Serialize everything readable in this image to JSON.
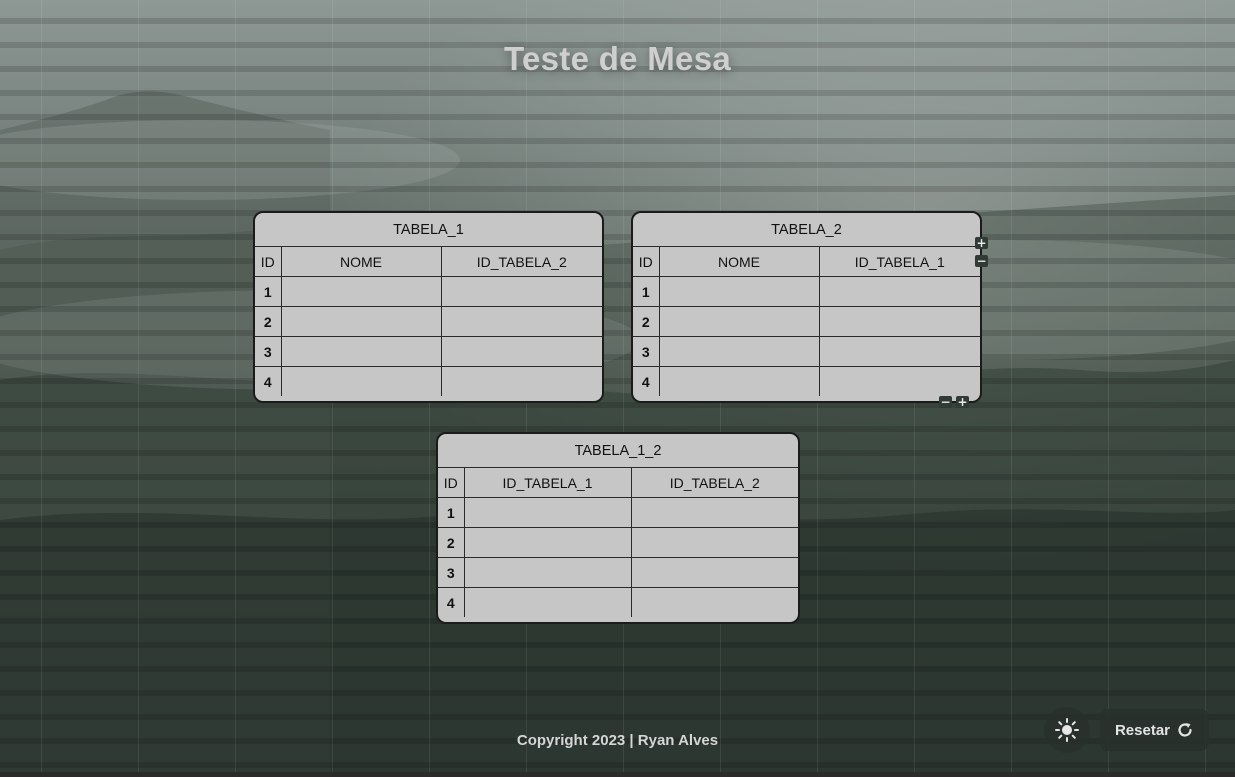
{
  "page": {
    "title": "Teste de Mesa",
    "footer": "Copyright 2023 | Ryan Alves"
  },
  "tables": {
    "t1": {
      "name": "TABELA_1",
      "cols": [
        "ID",
        "NOME",
        "ID_TABELA_2"
      ],
      "rows": [
        "1",
        "2",
        "3",
        "4"
      ]
    },
    "t2": {
      "name": "TABELA_2",
      "cols": [
        "ID",
        "NOME",
        "ID_TABELA_1"
      ],
      "rows": [
        "1",
        "2",
        "3",
        "4"
      ]
    },
    "t3": {
      "name": "TABELA_1_2",
      "cols": [
        "ID",
        "ID_TABELA_1",
        "ID_TABELA_2"
      ],
      "rows": [
        "1",
        "2",
        "3",
        "4"
      ]
    }
  },
  "controls": {
    "add": "+",
    "remove": "−"
  },
  "buttons": {
    "reset_label": "Resetar",
    "theme_icon": "sun-icon",
    "reset_icon": "refresh-icon"
  }
}
